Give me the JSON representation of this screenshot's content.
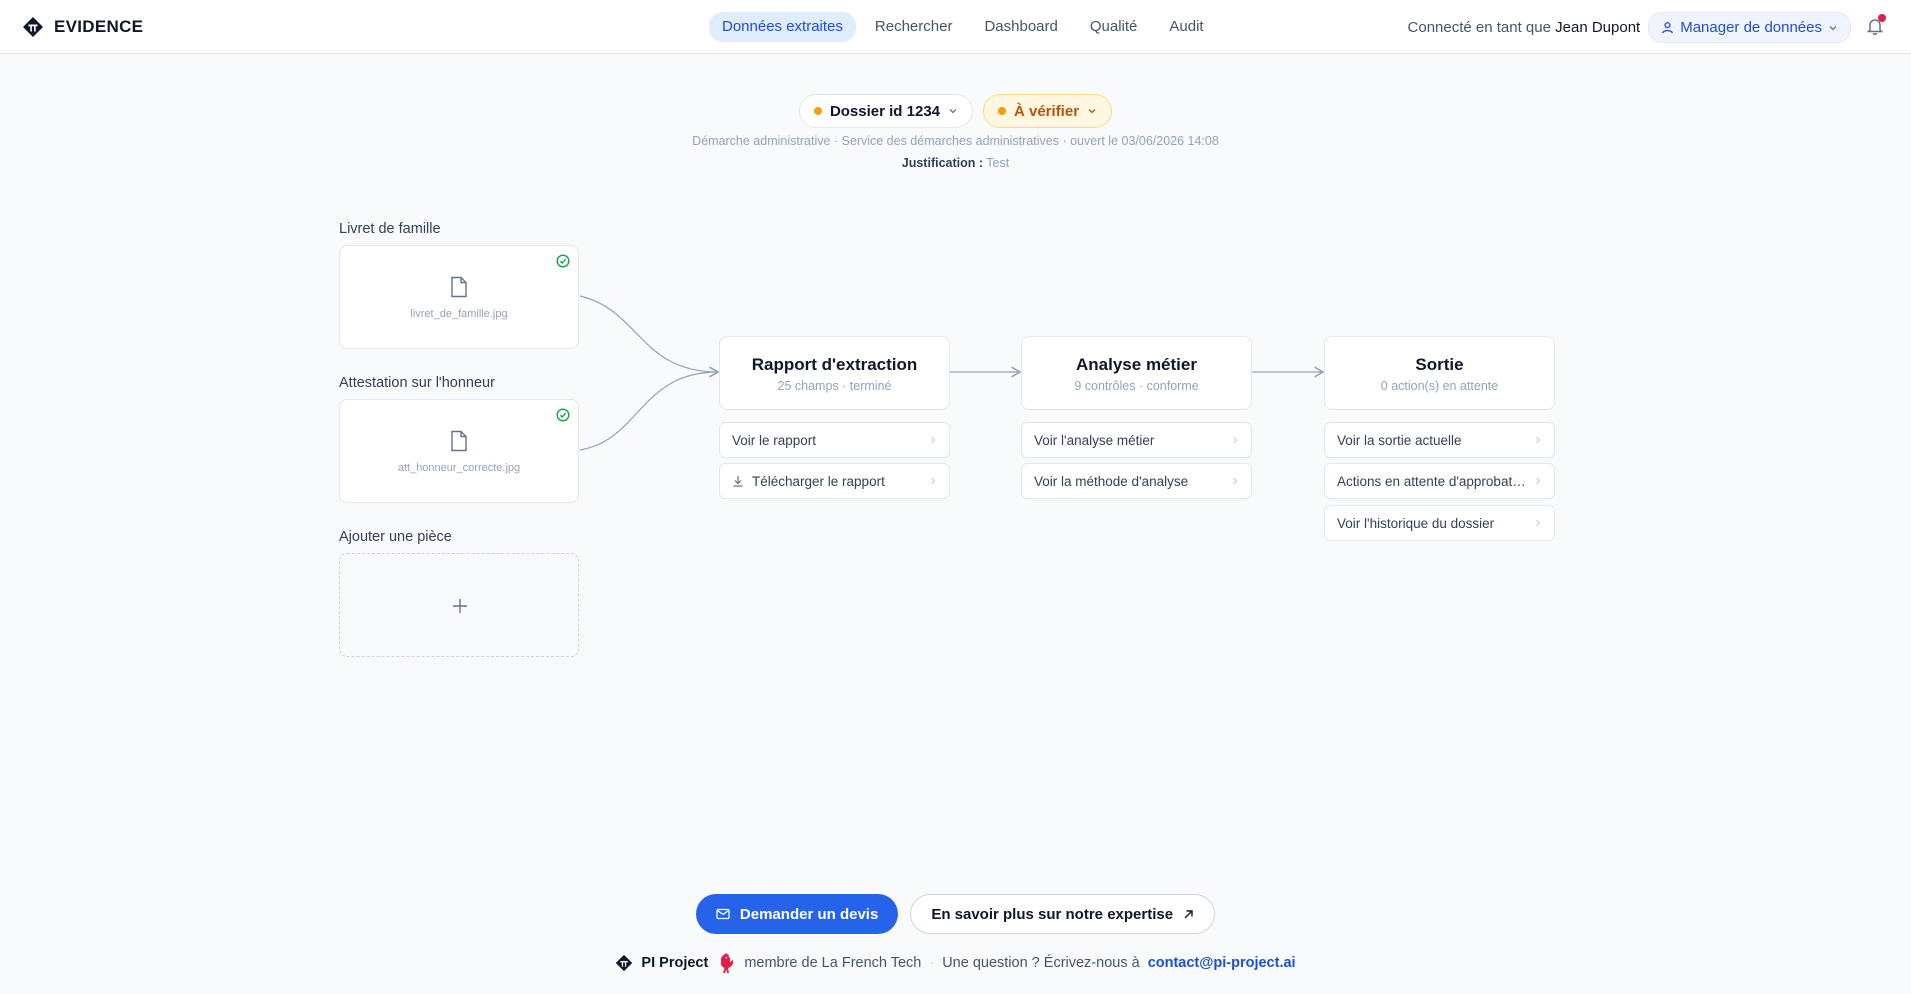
{
  "app": {
    "brand": "EVIDENCE"
  },
  "nav": {
    "items": [
      {
        "label": "Données extraites",
        "active": true
      },
      {
        "label": "Rechercher"
      },
      {
        "label": "Dashboard"
      },
      {
        "label": "Qualité"
      },
      {
        "label": "Audit"
      }
    ]
  },
  "user": {
    "connected_prefix": "Connecté en tant que",
    "name": "Jean Dupont",
    "role": "Manager de données"
  },
  "dossier": {
    "id_label": "Dossier id 1234",
    "status": "À vérifier",
    "meta": "Démarche administrative · Service des démarches administratives · ouvert le 03/06/2026 14:08",
    "justification_label": "Justification :",
    "justification_value": "Test"
  },
  "pieces": [
    {
      "title": "Livret de famille",
      "filename": "livret_de_famille.jpg"
    },
    {
      "title": "Attestation sur l'honneur",
      "filename": "att_honneur_correcte.jpg"
    }
  ],
  "add_piece": {
    "title": "Ajouter une pièce"
  },
  "stages": [
    {
      "title": "Rapport d'extraction",
      "subtitle": "25 champs · terminé",
      "actions": [
        "Voir le rapport",
        "Télécharger le rapport"
      ]
    },
    {
      "title": "Analyse métier",
      "subtitle": "9 contrôles · conforme",
      "actions": [
        "Voir l'analyse métier",
        "Voir la méthode d'analyse"
      ]
    },
    {
      "title": "Sortie",
      "subtitle": "0 action(s) en attente",
      "actions": [
        "Voir la sortie actuelle",
        "Actions en attente d'approbation",
        "Voir l'historique du dossier"
      ]
    }
  ],
  "footer": {
    "cta_primary": "Demander un devis",
    "cta_secondary": "En savoir plus sur notre expertise",
    "company": "PI Project",
    "member": "membre de La French Tech",
    "question": "Une question ? Écrivez-nous à",
    "email": "contact@pi-project.ai"
  },
  "colors": {
    "accent": "#2563eb",
    "status_warning": "#f59e0b",
    "success": "#16a34a",
    "notification": "#e11d48"
  }
}
